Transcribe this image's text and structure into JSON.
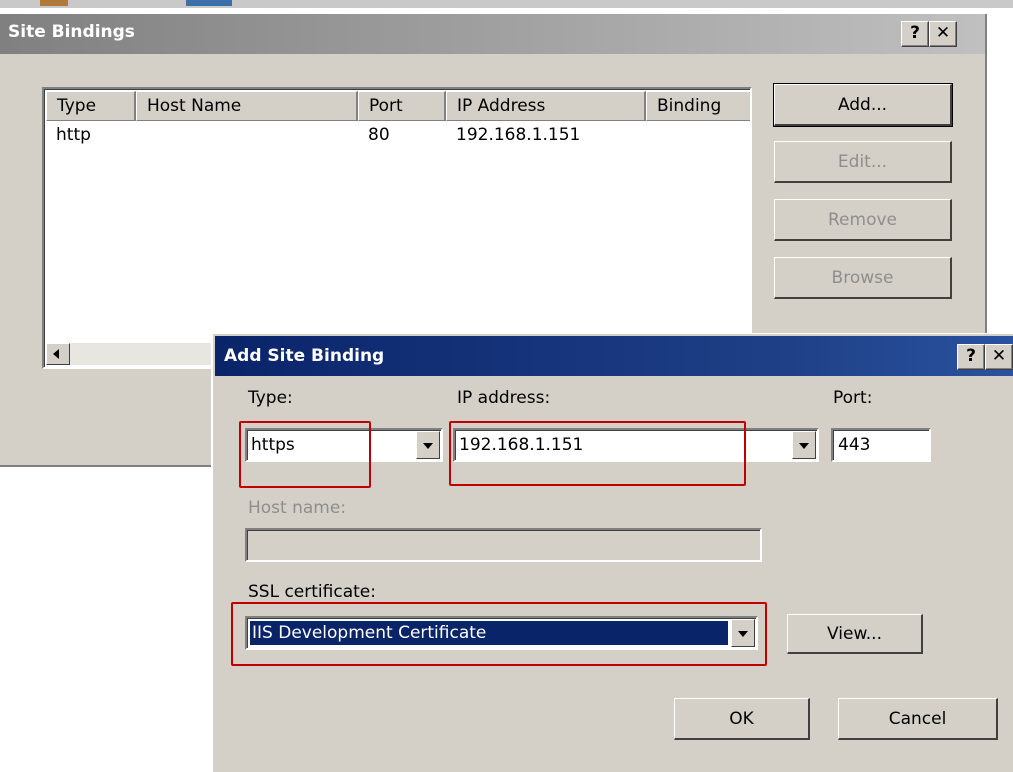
{
  "bindings_window": {
    "title": "Site Bindings",
    "help_label": "?",
    "close_label": "✕",
    "columns": [
      "Type",
      "Host Name",
      "Port",
      "IP Address",
      "Binding"
    ],
    "rows": [
      {
        "type": "http",
        "host": "",
        "port": "80",
        "ip": "192.168.1.151",
        "binding": ""
      }
    ],
    "buttons": {
      "add": "Add...",
      "edit": "Edit...",
      "remove": "Remove",
      "browse": "Browse"
    }
  },
  "add_dialog": {
    "title": "Add Site Binding",
    "help_label": "?",
    "close_label": "✕",
    "type_label": "Type:",
    "type_value": "https",
    "ip_label": "IP address:",
    "ip_value": "192.168.1.151",
    "port_label": "Port:",
    "port_value": "443",
    "host_label": "Host name:",
    "host_value": "",
    "ssl_label": "SSL certificate:",
    "ssl_value": "IIS Development Certificate",
    "view_label": "View...",
    "ok_label": "OK",
    "cancel_label": "Cancel"
  },
  "colors": {
    "highlight": "#c00000",
    "title_active": "#0a246a",
    "face": "#d4d0c8"
  }
}
